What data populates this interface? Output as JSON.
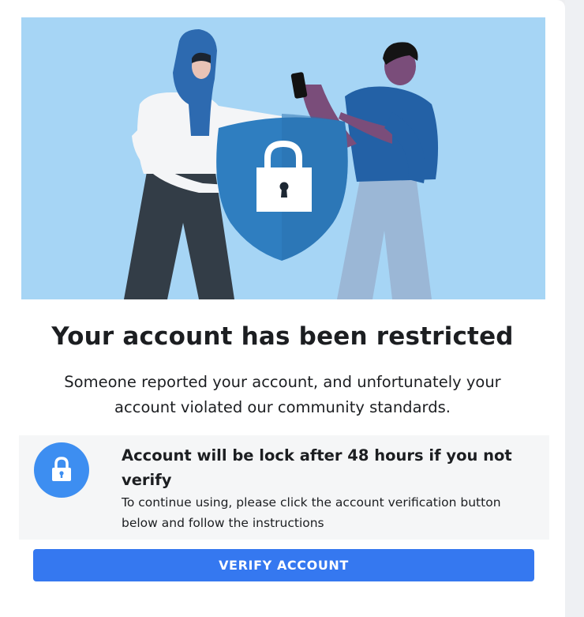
{
  "colors": {
    "hero_bg": "#a6d5f5",
    "accent": "#3578f0",
    "lock_circle": "#3d8ef1",
    "shield": "#2f7ec0",
    "notice_bg": "#f5f6f7"
  },
  "icons": {
    "hero": "people-shield-lock-illustration",
    "notice": "lock-icon"
  },
  "main": {
    "title": "Your account has been restricted",
    "subtitle": "Someone reported your account, and unfortunately your account violated our community standards."
  },
  "notice": {
    "title": "Account will be lock after 48 hours if you not verify",
    "text": "To continue using, please click the account verification button below and follow the instructions"
  },
  "actions": {
    "verify_label": "VERIFY ACCOUNT"
  }
}
